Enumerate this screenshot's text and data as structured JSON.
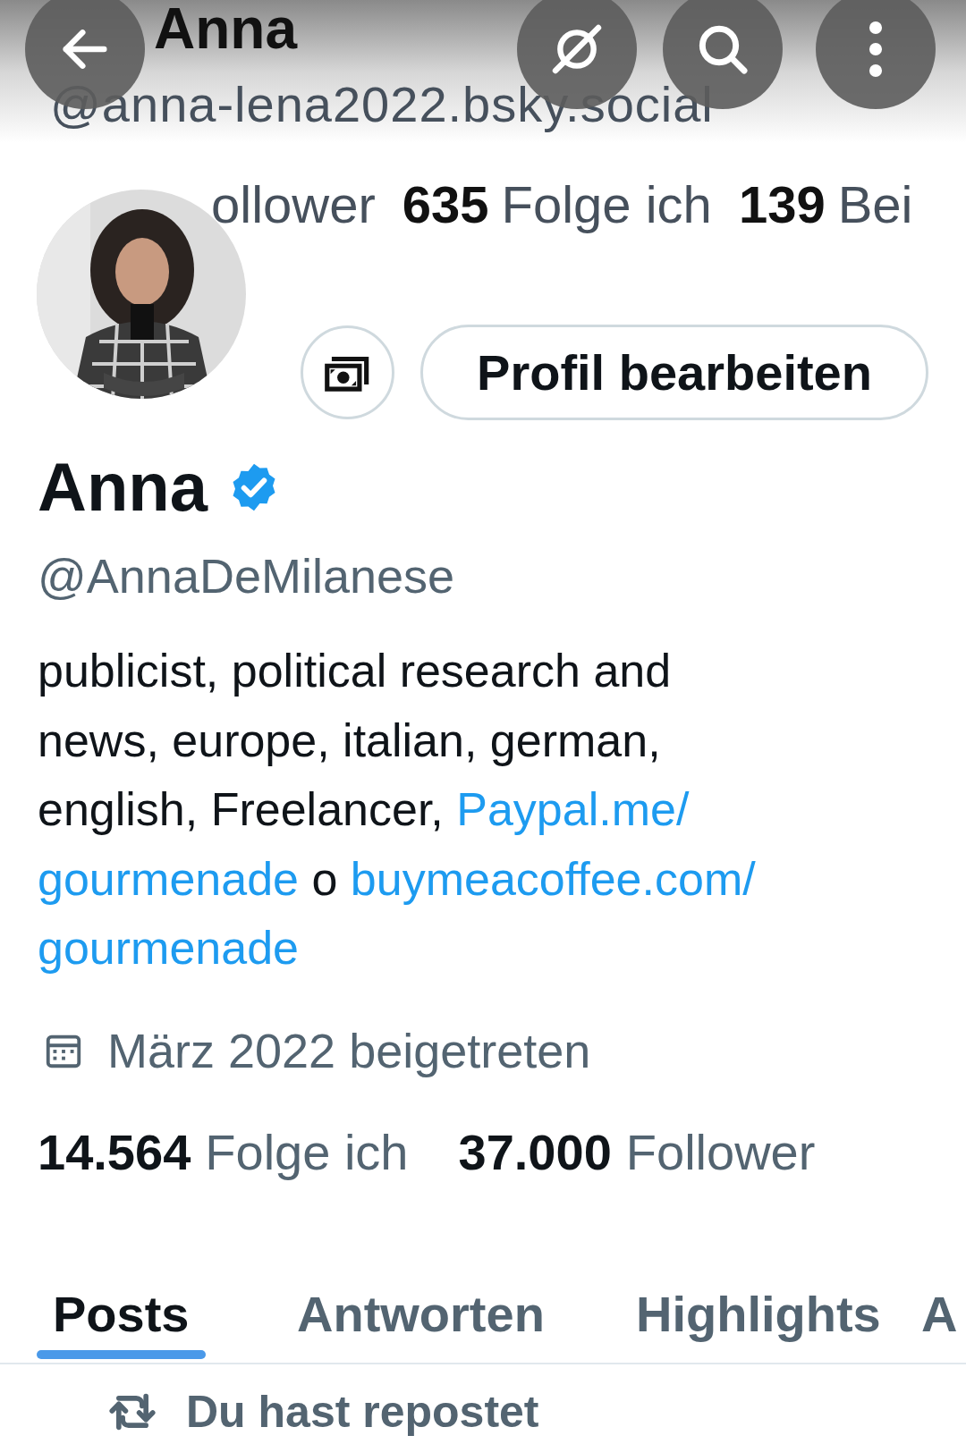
{
  "header": {
    "title": "Anna",
    "handle": "@anna-lena2022.bsky.social"
  },
  "header_stats": [
    {
      "label": "ollower"
    },
    {
      "count": "635",
      "label": "Folge ich"
    },
    {
      "count": "139",
      "label": "Bei"
    }
  ],
  "avatar": {
    "kind": "picture"
  },
  "actions": {
    "edit_button": "Profil bearbeiten"
  },
  "profile": {
    "name": "Anna",
    "verified": true,
    "handle": "@AnnaDeMilanese"
  },
  "bio_lines": [
    [
      {
        "kind": "text",
        "text": "publicist, political research and"
      }
    ],
    [
      {
        "kind": "text",
        "text": "news, europe, italian, german,"
      }
    ],
    [
      {
        "kind": "text",
        "text": "english, Freelancer, "
      },
      {
        "kind": "link",
        "text": "Paypal.me/"
      }
    ],
    [
      {
        "kind": "link",
        "text": "gourmenade"
      },
      {
        "kind": "text",
        "text": " o "
      },
      {
        "kind": "link",
        "text": "buymeacoffee.com/"
      }
    ],
    [
      {
        "kind": "link",
        "text": "gourmenade"
      }
    ]
  ],
  "joined": "März 2022 beigetreten",
  "follow_stats": [
    {
      "count": "14.564",
      "label": "Folge ich"
    },
    {
      "count": "37.000",
      "label": "Follower"
    }
  ],
  "tabs": [
    {
      "label": "Posts",
      "selected": true
    },
    {
      "label": "Antworten",
      "selected": false
    },
    {
      "label": "Highlights",
      "selected": false
    },
    {
      "label": "A",
      "selected": false
    }
  ],
  "repost_note": "Du hast repostet"
}
